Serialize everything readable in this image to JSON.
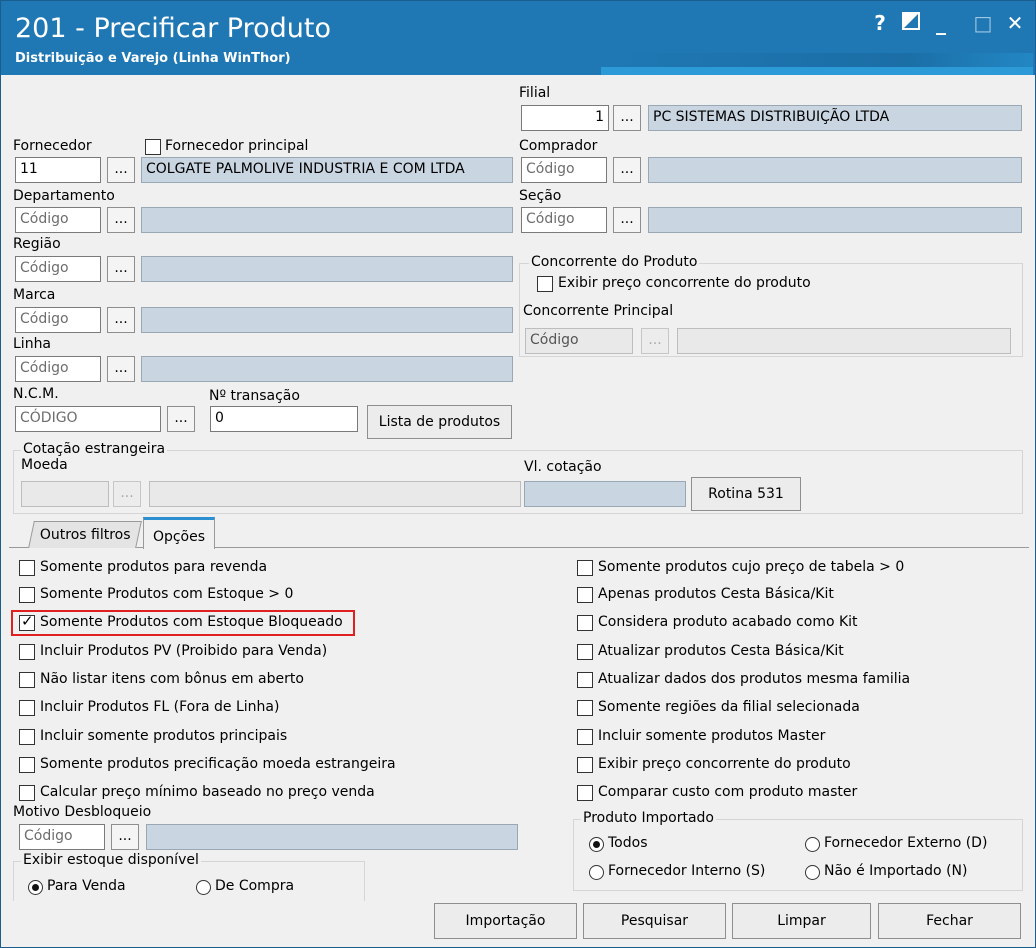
{
  "window": {
    "title": "201 - Precificar Produto",
    "subtitle": "Distribuição e Varejo (Linha WinThor)",
    "controls": [
      "?",
      "◩",
      "_",
      "□",
      "✕"
    ]
  },
  "filial": {
    "label": "Filial",
    "code": "1",
    "name": "PC SISTEMAS DISTRIBUIÇÃO LTDA"
  },
  "fornecedor": {
    "label": "Fornecedor",
    "code": "11",
    "name": "COLGATE PALMOLIVE INDUSTRIA  E COM LTDA",
    "principal_label": "Fornecedor principal"
  },
  "comprador": {
    "label": "Comprador",
    "placeholder": "Código"
  },
  "departamento": {
    "label": "Departamento",
    "placeholder": "Código"
  },
  "secao": {
    "label": "Seção",
    "placeholder": "Código"
  },
  "regiao": {
    "label": "Região",
    "placeholder": "Código"
  },
  "marca": {
    "label": "Marca",
    "placeholder": "Código"
  },
  "linha": {
    "label": "Linha",
    "placeholder": "Código"
  },
  "ncm": {
    "label": "N.C.M.",
    "placeholder": "CÓDIGO"
  },
  "transacao": {
    "label": "Nº transação",
    "value": "0"
  },
  "lista_produtos": "Lista de produtos",
  "concorrente": {
    "group": "Concorrente do Produto",
    "exibir": "Exibir preço concorrente do produto",
    "principal_label": "Concorrente Principal",
    "placeholder": "Código"
  },
  "cotacao": {
    "group": "Cotação estrangeira",
    "moeda_label": "Moeda",
    "vl_label": "Vl. cotação",
    "rotina_button": "Rotina 531"
  },
  "ellipsis": "...",
  "tabs": [
    {
      "label": "Outros filtros"
    },
    {
      "label": "Opções"
    }
  ],
  "options_left": [
    {
      "label": "Somente produtos para revenda",
      "checked": false
    },
    {
      "label": "Somente Produtos com Estoque > 0",
      "checked": false
    },
    {
      "label": "Somente Produtos com Estoque Bloqueado",
      "checked": true
    },
    {
      "label": "Incluir Produtos PV (Proibido para Venda)",
      "checked": false
    },
    {
      "label": "Não listar itens com bônus em aberto",
      "checked": false
    },
    {
      "label": "Incluir Produtos FL (Fora de Linha)",
      "checked": false
    },
    {
      "label": "Incluir somente produtos principais",
      "checked": false
    },
    {
      "label": "Somente produtos precificação moeda estrangeira",
      "checked": false
    },
    {
      "label": "Calcular preço mínimo baseado no preço venda",
      "checked": false
    }
  ],
  "options_right": [
    {
      "label": "Somente produtos cujo preço de tabela > 0",
      "checked": false
    },
    {
      "label": "Apenas produtos Cesta Básica/Kit",
      "checked": false
    },
    {
      "label": "Considera produto acabado como Kit",
      "checked": false
    },
    {
      "label": "Atualizar produtos Cesta Básica/Kit",
      "checked": false
    },
    {
      "label": "Atualizar dados dos produtos mesma familia",
      "checked": false
    },
    {
      "label": "Somente regiões da filial selecionada",
      "checked": false
    },
    {
      "label": "Incluir somente produtos Master",
      "checked": false
    },
    {
      "label": "Exibir preço concorrente do produto",
      "checked": false
    },
    {
      "label": "Comparar custo com produto master",
      "checked": false
    }
  ],
  "motivo": {
    "label": "Motivo Desbloqueio",
    "placeholder": "Código"
  },
  "estoque": {
    "group": "Exibir estoque disponível",
    "options": [
      {
        "label": "Para Venda",
        "selected": true
      },
      {
        "label": "De Compra",
        "selected": false
      }
    ]
  },
  "importado": {
    "group": "Produto Importado",
    "options": [
      {
        "label": "Todos",
        "selected": true
      },
      {
        "label": "Fornecedor Externo (D)",
        "selected": false
      },
      {
        "label": "Fornecedor Interno (S)",
        "selected": false
      },
      {
        "label": "Não é Importado (N)",
        "selected": false
      }
    ]
  },
  "buttons": {
    "importacao": "Importação",
    "pesquisar": "Pesquisar",
    "limpar": "Limpar",
    "fechar": "Fechar"
  },
  "colors": {
    "titlebar": "#1f78b4",
    "readonly_field": "#c9d5e1",
    "highlight": "#e02020"
  }
}
